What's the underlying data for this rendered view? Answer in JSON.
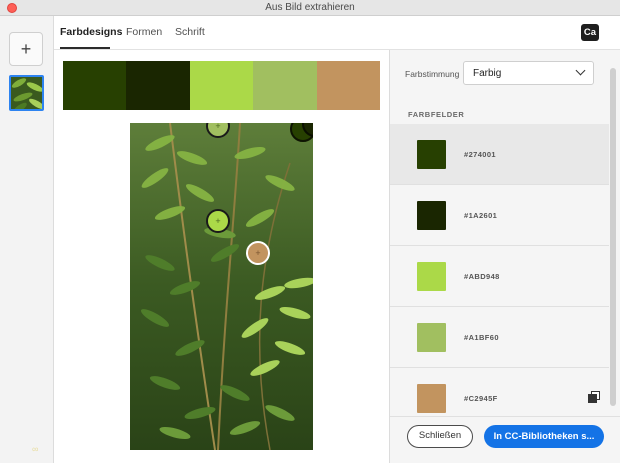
{
  "window": {
    "title": "Aus Bild extrahieren"
  },
  "left_rail": {
    "add_label": "+",
    "thumbnail": "leaf-photo-thumbnail"
  },
  "tabs": [
    {
      "label": "Farbdesigns",
      "active": true
    },
    {
      "label": "Formen",
      "active": false
    },
    {
      "label": "Schrift",
      "active": false
    }
  ],
  "app_badge": "Ca",
  "palette": [
    "#274001",
    "#1A2601",
    "#ABD948",
    "#A1BF60",
    "#C2945F"
  ],
  "settings": {
    "mood_label": "Farbstimmung",
    "mood_value": "Farbig",
    "section_title": "FARBFELDER"
  },
  "swatches": [
    {
      "hex": "#274001",
      "selected": true
    },
    {
      "hex": "#1A2601",
      "selected": false
    },
    {
      "hex": "#ABD948",
      "selected": false
    },
    {
      "hex": "#A1BF60",
      "selected": false
    },
    {
      "hex": "#C2945F",
      "selected": false
    }
  ],
  "buttons": {
    "close": "Schließen",
    "save": "In CC-Bibliotheken s..."
  },
  "icons": {
    "close": "close-window-icon",
    "add": "plus-icon",
    "chevron": "chevron-down-icon",
    "copy": "copy-icon",
    "marker_plus": "crosshair-plus-icon"
  }
}
